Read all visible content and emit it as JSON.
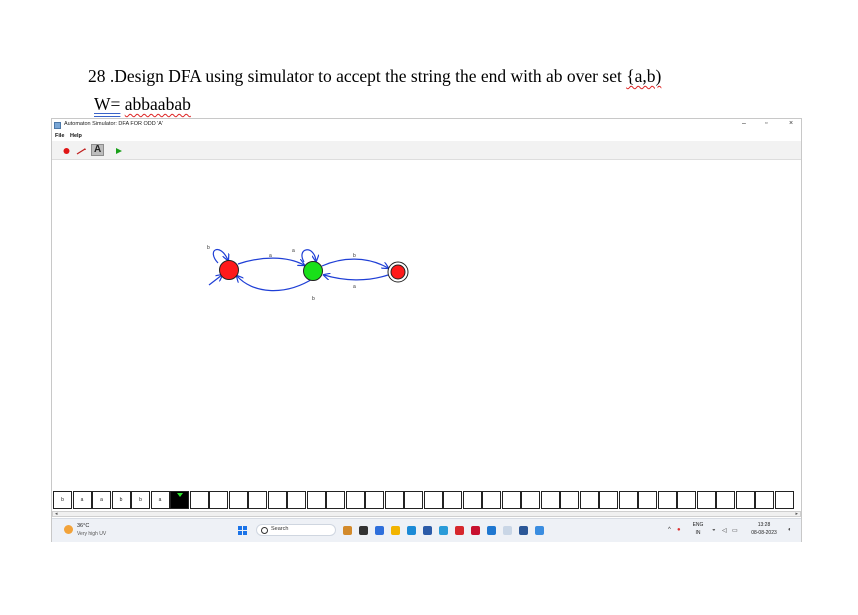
{
  "document": {
    "heading_number": "28",
    "heading_text": ".Design DFA using simulator to accept the string the end with ab over set",
    "heading_set": "{a,b)",
    "sub_prefix": "W=",
    "sub_value": "abbaabab"
  },
  "window": {
    "title": "Automaton Simulator: DFA FOR ODD 'A'",
    "minimize": "–",
    "maximize": "▫",
    "close": "×"
  },
  "menu": {
    "file": "File",
    "help": "Help"
  },
  "toolbar": {
    "state_tool": "state-tool-icon",
    "transition_tool": "transition-tool-icon",
    "label_tool": "A",
    "run_tool": "run-icon"
  },
  "diagram": {
    "states": [
      {
        "role": "start",
        "color": "#ff1a1a"
      },
      {
        "role": "intermediate",
        "color": "#19e019"
      },
      {
        "role": "accept",
        "color": "#ff1a1a"
      }
    ],
    "edge_color": "#1f3fd6",
    "labels": {
      "loop_q0": "b",
      "q0_q1": "a",
      "loop_q1": "a",
      "q1_q2": "b",
      "q2_q1": "a",
      "q1_q0": "b"
    }
  },
  "tape": {
    "cells": [
      "b",
      "a",
      "a",
      "b",
      "b",
      "a"
    ],
    "head_index": 6,
    "empty_cells": 32
  },
  "taskbar": {
    "weather_temp": "36°C",
    "weather_desc": "Very high UV",
    "search_placeholder": "Search",
    "apps": [
      {
        "name": "widgets-app-icon",
        "color": "#d38a2b"
      },
      {
        "name": "terminal-app-icon",
        "color": "#333333"
      },
      {
        "name": "chat-app-icon",
        "color": "#2f6fdb"
      },
      {
        "name": "paint-app-icon",
        "color": "#f2b400"
      },
      {
        "name": "edge-browser-icon",
        "color": "#1b8ad6"
      },
      {
        "name": "store-app-icon",
        "color": "#2c5ba8"
      },
      {
        "name": "launcher-app-icon",
        "color": "#2a9bd8"
      },
      {
        "name": "opera-browser-icon",
        "color": "#d6272c"
      },
      {
        "name": "mcafee-app-icon",
        "color": "#c8102e"
      },
      {
        "name": "blue-app-icon",
        "color": "#1f77d0"
      },
      {
        "name": "java-app-icon",
        "color": "#c9d6e6"
      },
      {
        "name": "word-app-icon",
        "color": "#2b5797"
      },
      {
        "name": "photos-app-icon",
        "color": "#3a8de0"
      }
    ],
    "lang_top": "ENG",
    "lang_bottom": "IN",
    "time": "13:28",
    "date": "08-08-2023"
  }
}
